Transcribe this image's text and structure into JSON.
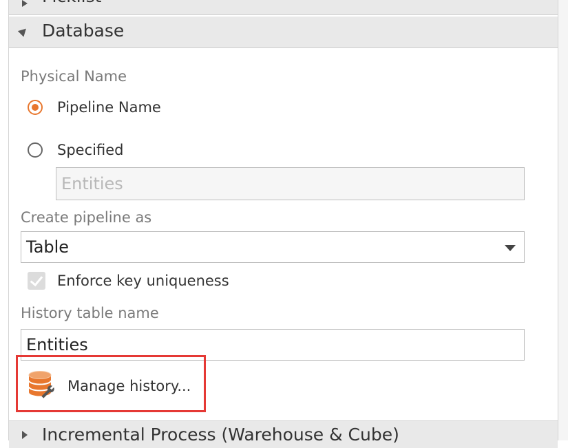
{
  "sections": {
    "picklist": {
      "title": "Picklist"
    },
    "database": {
      "title": "Database"
    },
    "incremental": {
      "title": "Incremental Process (Warehouse & Cube)"
    }
  },
  "physical_name": {
    "label": "Physical Name",
    "options": [
      {
        "label": "Pipeline Name",
        "selected": true
      },
      {
        "label": "Specified",
        "selected": false
      }
    ],
    "specified_placeholder": "Entities"
  },
  "create_pipeline": {
    "label": "Create pipeline as",
    "value": "Table"
  },
  "enforce_key": {
    "label": "Enforce key uniqueness",
    "checked": true,
    "disabled": true
  },
  "history_table": {
    "label": "History table name",
    "value": "Entities"
  },
  "manage_history": {
    "label": "Manage history...",
    "icon": "database-wrench-icon"
  },
  "colors": {
    "accent": "#e8772e",
    "highlight": "#e53935",
    "header_bg": "#e9e9e9"
  }
}
